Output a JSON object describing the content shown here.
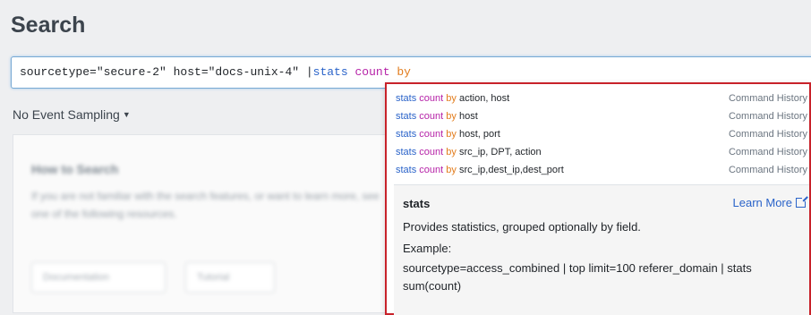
{
  "page": {
    "title": "Search"
  },
  "search": {
    "query_plain": "sourcetype=\"secure-2\" host=\"docs-unix-4\" |",
    "query_cmd": "stats",
    "query_fn": "count",
    "query_by": "by"
  },
  "sampling": {
    "label": "No Event Sampling"
  },
  "help_card": {
    "title": "How to Search",
    "body": "If you are not familiar with the search features, or want to learn more, see one of the following resources.",
    "buttons": [
      "Documentation",
      "Tutorial"
    ]
  },
  "suggestions": [
    {
      "cmd": "stats",
      "fn": "count",
      "by": "by",
      "rest": " action, host",
      "source": "Command History"
    },
    {
      "cmd": "stats",
      "fn": "count",
      "by": "by",
      "rest": " host",
      "source": "Command History"
    },
    {
      "cmd": "stats",
      "fn": "count",
      "by": "by",
      "rest": " host, port",
      "source": "Command History"
    },
    {
      "cmd": "stats",
      "fn": "count",
      "by": "by",
      "rest": " src_ip, DPT, action",
      "source": "Command History"
    },
    {
      "cmd": "stats",
      "fn": "count",
      "by": "by",
      "rest": " src_ip,dest_ip,dest_port",
      "source": "Command History"
    }
  ],
  "help": {
    "command": "stats",
    "learn_more": "Learn More",
    "description": "Provides statistics, grouped optionally by field.",
    "example_label": "Example:",
    "example": "sourcetype=access_combined | top limit=100 referer_domain | stats sum(count)"
  },
  "colors": {
    "command": "#2a63c9",
    "function": "#b623a8",
    "keyword_by": "#e27d1e",
    "highlight_border": "#c8222a"
  },
  "icons": [
    "caret-down-icon",
    "external-link-icon"
  ]
}
